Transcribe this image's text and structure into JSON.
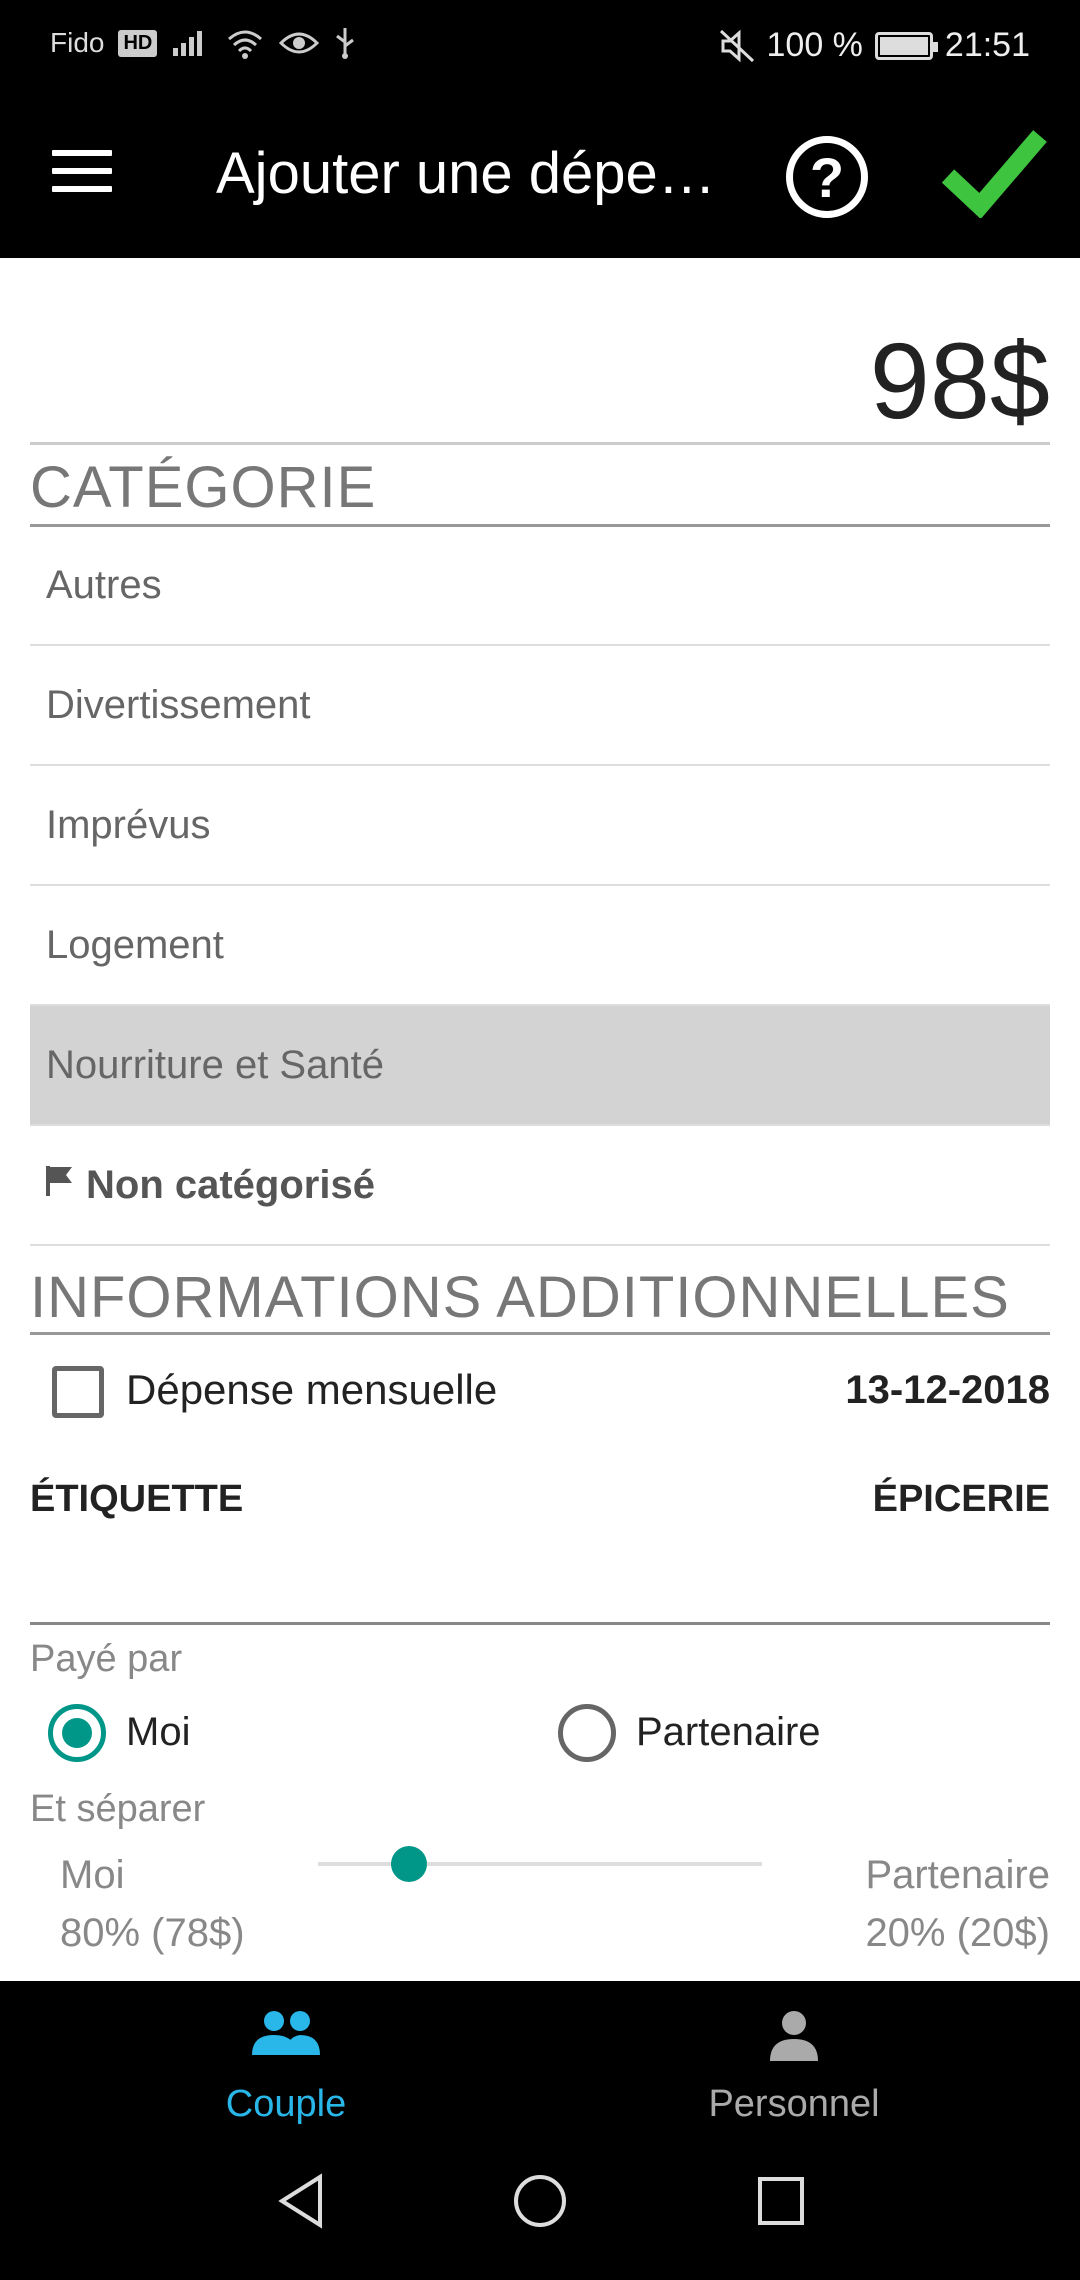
{
  "status_bar": {
    "carrier": "Fido",
    "hd_badge": "HD",
    "battery_text": "100 %",
    "battery_level": 1.0,
    "time": "21:51"
  },
  "app_bar": {
    "title": "Ajouter une dépe…",
    "help_glyph": "?",
    "check_color": "#3ec43e"
  },
  "amount": "98$",
  "category_section": {
    "title": "CATÉGORIE",
    "items": [
      {
        "label": "Autres",
        "selected": false
      },
      {
        "label": "Divertissement",
        "selected": false
      },
      {
        "label": "Imprévus",
        "selected": false
      },
      {
        "label": "Logement",
        "selected": false
      },
      {
        "label": "Nourriture et Santé",
        "selected": true
      },
      {
        "label": "Non catégorisé",
        "selected": false,
        "icon": "flag-icon"
      }
    ]
  },
  "additional_section": {
    "title": "INFORMATIONS ADDITIONNELLES",
    "monthly_label": "Dépense mensuelle",
    "monthly_checked": false,
    "date": "13-12-2018",
    "label_key": "ÉTIQUETTE",
    "label_value": "ÉPICERIE",
    "paid_by_label": "Payé par",
    "payer_options": [
      {
        "label": "Moi",
        "selected": true
      },
      {
        "label": "Partenaire",
        "selected": false
      }
    ],
    "split_label": "Et séparer",
    "split_left_name": "Moi",
    "split_left_value": "80% (78$)",
    "split_right_name": "Partenaire",
    "split_right_value": "20% (20$)",
    "split_ratio_partner": 0.2
  },
  "bottom_nav": {
    "tabs": [
      {
        "label": "Couple",
        "icon": "people-icon",
        "active": true
      },
      {
        "label": "Personnel",
        "icon": "person-icon",
        "active": false
      }
    ]
  },
  "colors": {
    "accent": "#009688",
    "active_tab": "#29b6e8",
    "selected_row": "#d3d3d3"
  }
}
